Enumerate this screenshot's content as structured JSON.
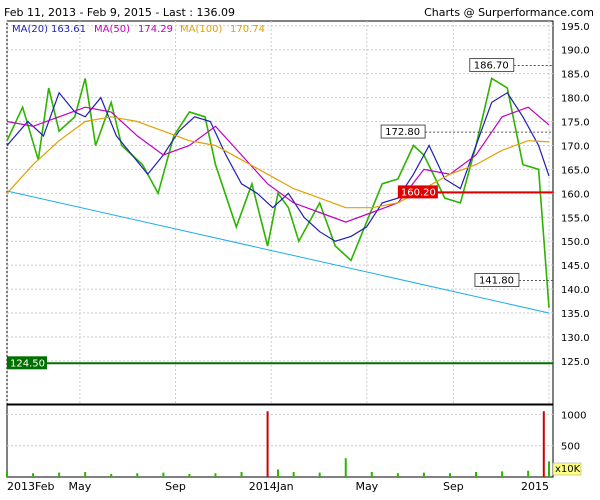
{
  "header": {
    "range": "Feb 11, 2013 - Feb 9, 2015 - Last : 136.09",
    "credit": "Charts @ Surperformance.com"
  },
  "legend": {
    "ma20": {
      "label": "MA(20)",
      "value": "163.61",
      "color": "#1f1fb3"
    },
    "ma50": {
      "label": "MA(50)",
      "value": "174.29",
      "color": "#c000c0"
    },
    "ma100": {
      "label": "MA(100)",
      "value": "170.74",
      "color": "#e0a000"
    }
  },
  "chart_data": {
    "type": "line",
    "x_tick_labels": [
      "2013Feb",
      "May",
      "Sep",
      "2014Jan",
      "May",
      "Sep",
      "2015"
    ],
    "price_axis": {
      "ylim": [
        116,
        196
      ],
      "ticks": [
        125,
        130,
        135,
        140,
        145,
        150,
        155,
        160,
        165,
        170,
        175,
        180,
        185,
        190,
        195
      ]
    },
    "volume_axis": {
      "unit_label": "x10K",
      "ticks": [
        500,
        1000
      ],
      "ylim": [
        0,
        1150
      ]
    },
    "grid": true,
    "series": [
      {
        "name": "Price",
        "color": "#2db300",
        "x": [
          0,
          3,
          6,
          8,
          10,
          13,
          15,
          17,
          20,
          22,
          26,
          29,
          32,
          35,
          38,
          40,
          44,
          47,
          50,
          52,
          54,
          56,
          60,
          63,
          66,
          69,
          72,
          75,
          78,
          80,
          84,
          87,
          90,
          93,
          96,
          99,
          102,
          104
        ],
        "values": [
          171,
          178,
          167,
          182,
          173,
          176,
          184,
          170,
          179,
          170,
          166,
          160,
          172,
          177,
          176,
          166,
          153,
          162,
          149,
          160,
          157,
          150,
          158,
          149,
          146,
          154,
          162,
          163,
          170,
          168,
          159,
          158,
          170,
          184,
          182,
          166,
          165,
          136.09
        ]
      },
      {
        "name": "MA(20)",
        "color": "#1f1fb3",
        "x": [
          0,
          4,
          7,
          10,
          13,
          15,
          18,
          21,
          24,
          27,
          30,
          33,
          36,
          39,
          42,
          45,
          48,
          51,
          54,
          57,
          60,
          63,
          66,
          69,
          72,
          75,
          78,
          81,
          84,
          87,
          90,
          93,
          96,
          99,
          102,
          104
        ],
        "values": [
          170,
          175,
          172,
          181,
          177,
          176,
          180,
          172,
          168,
          164,
          168,
          173,
          176,
          175,
          168,
          162,
          160,
          157,
          160,
          155,
          152,
          150,
          151,
          153,
          158,
          159,
          164,
          170,
          163,
          161,
          170,
          179,
          181,
          176,
          170,
          163.61
        ]
      },
      {
        "name": "MA(50)",
        "color": "#c000c0",
        "x": [
          0,
          5,
          10,
          15,
          20,
          25,
          30,
          35,
          40,
          45,
          50,
          55,
          60,
          65,
          70,
          75,
          80,
          85,
          90,
          95,
          100,
          104
        ],
        "values": [
          175,
          174,
          176,
          178,
          177,
          172,
          168,
          170,
          174,
          168,
          162,
          158,
          156,
          154,
          156,
          158,
          165,
          164,
          168,
          176,
          178,
          174.29
        ]
      },
      {
        "name": "MA(100)",
        "color": "#e0a000",
        "x": [
          0,
          5,
          10,
          15,
          20,
          25,
          30,
          35,
          40,
          45,
          50,
          55,
          60,
          65,
          70,
          75,
          80,
          85,
          90,
          95,
          100,
          104
        ],
        "values": [
          160,
          166,
          171,
          175,
          176,
          175,
          173,
          171,
          170,
          167,
          164,
          161,
          159,
          157,
          157,
          158,
          161,
          164,
          166,
          169,
          171,
          170.74
        ]
      }
    ],
    "volume": {
      "x": [
        0,
        5,
        10,
        15,
        20,
        25,
        30,
        35,
        40,
        45,
        50,
        52,
        55,
        60,
        65,
        70,
        75,
        80,
        85,
        90,
        95,
        100,
        103,
        104
      ],
      "values": [
        90,
        60,
        70,
        80,
        50,
        60,
        70,
        50,
        60,
        80,
        1050,
        120,
        80,
        70,
        300,
        80,
        60,
        70,
        60,
        80,
        90,
        100,
        1050,
        250
      ]
    },
    "trendline": {
      "color": "#1eaee8",
      "from": {
        "x": 0,
        "y": 160.5
      },
      "to": {
        "x": 104,
        "y": 135
      }
    },
    "horizontal_lines": [
      {
        "label": "160.20",
        "value": 160.2,
        "color": "#e00000"
      },
      {
        "label": "124.50",
        "value": 124.5,
        "color": "#007000"
      }
    ],
    "price_labels": [
      {
        "label": "186.70",
        "value": 186.7,
        "x": 98
      },
      {
        "label": "172.80",
        "value": 172.8,
        "x": 81
      },
      {
        "label": "141.80",
        "value": 141.8,
        "x": 99
      }
    ]
  }
}
